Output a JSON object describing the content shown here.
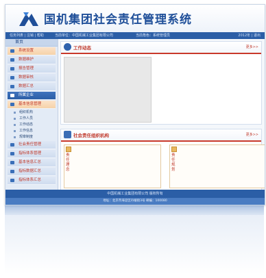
{
  "header": {
    "title": "国机集团社会责任管理系统"
  },
  "topbar": {
    "user": "任务列表 | 注销 | 帮助",
    "org": "当前单位：中国机械工业集团有限公司",
    "mid": "当前角色：系统管理员",
    "date": "2012年 | 退出"
  },
  "sidebar": {
    "head": "首页",
    "items": [
      {
        "label": "系统设置",
        "style": "orange"
      },
      {
        "label": "数据维护",
        "style": "blue"
      },
      {
        "label": "报告管理",
        "style": "blue"
      },
      {
        "label": "数据审核",
        "style": "blue"
      },
      {
        "label": "数据汇总",
        "style": "blue"
      },
      {
        "label": "所属企业",
        "style": "active"
      },
      {
        "label": "基本信息管理",
        "style": "orange"
      }
    ],
    "subitems": [
      "组织机构",
      "工作人员",
      "工作动态",
      "工作信息",
      "规章制度"
    ],
    "items2": [
      {
        "label": "社会责任管理"
      },
      {
        "label": "指标体系管理"
      },
      {
        "label": "基本信息汇总"
      },
      {
        "label": "指标数据汇总"
      },
      {
        "label": "指标体系汇总"
      }
    ]
  },
  "panels": {
    "news": {
      "title": "工作动态",
      "more": "更多>>"
    },
    "org": {
      "title": "社会责任组织机构",
      "more": "更多>>"
    },
    "col_left": "责任理念",
    "col_right": "责任规划"
  },
  "footer": {
    "line1": "中国机械工业集团有限公司 版权所有",
    "line2": "地址：北京市海淀区丹棱街3号 邮编：100080"
  },
  "colors": {
    "primary": "#2b5ea6",
    "accent": "#c0392b"
  }
}
